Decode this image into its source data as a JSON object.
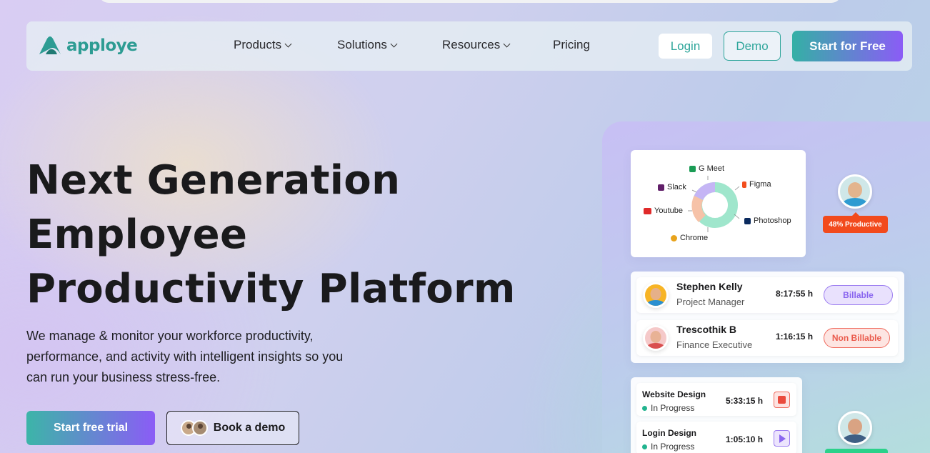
{
  "brand": {
    "name": "apploye",
    "color": "#2d9c93"
  },
  "nav": {
    "items": [
      {
        "label": "Products",
        "has_dropdown": true
      },
      {
        "label": "Solutions",
        "has_dropdown": true
      },
      {
        "label": "Resources",
        "has_dropdown": true
      },
      {
        "label": "Pricing",
        "has_dropdown": false
      }
    ],
    "login": "Login",
    "demo": "Demo",
    "start": "Start for Free"
  },
  "hero": {
    "title_lines": [
      "Next Generation",
      "Employee",
      "Productivity Platform"
    ],
    "subtitle_lines": [
      "We manage & monitor your workforce productivity,",
      "performance, and activity with intelligent insights so you",
      "can run your business stress-free."
    ],
    "trial_button": "Start free trial",
    "demo_button": "Book a demo"
  },
  "app_usage": {
    "apps": [
      {
        "name": "G Meet",
        "icon": "google-meet-icon",
        "color": "#1a9c55"
      },
      {
        "name": "Figma",
        "icon": "figma-icon",
        "color": "#f24e1e"
      },
      {
        "name": "Slack",
        "icon": "slack-icon",
        "color": "#611f69"
      },
      {
        "name": "Youtube",
        "icon": "youtube-icon",
        "color": "#e02a2a"
      },
      {
        "name": "Photoshop",
        "icon": "photoshop-icon",
        "color": "#0a2a5e"
      },
      {
        "name": "Chrome",
        "icon": "chrome-icon",
        "color": "#e8a31c"
      }
    ],
    "donut_colors": [
      "#c5b5f5",
      "#f6c2a8",
      "#9fe6cc"
    ],
    "productivity_badge": "48% Productive"
  },
  "employees": [
    {
      "name": "Stephen Kelly",
      "role": "Project Manager",
      "time": "8:17:55 h",
      "tag": "Billable"
    },
    {
      "name": "Trescothik B",
      "role": "Finance Executive",
      "time": "1:16:15 h",
      "tag": "Non Billable"
    }
  ],
  "tasks": [
    {
      "name": "Website Design",
      "status": "In Progress",
      "time": "5:33:15 h",
      "control": "stop-icon"
    },
    {
      "name": "Login Design",
      "status": "In Progress",
      "time": "1:05:10 h",
      "control": "play-icon"
    }
  ]
}
